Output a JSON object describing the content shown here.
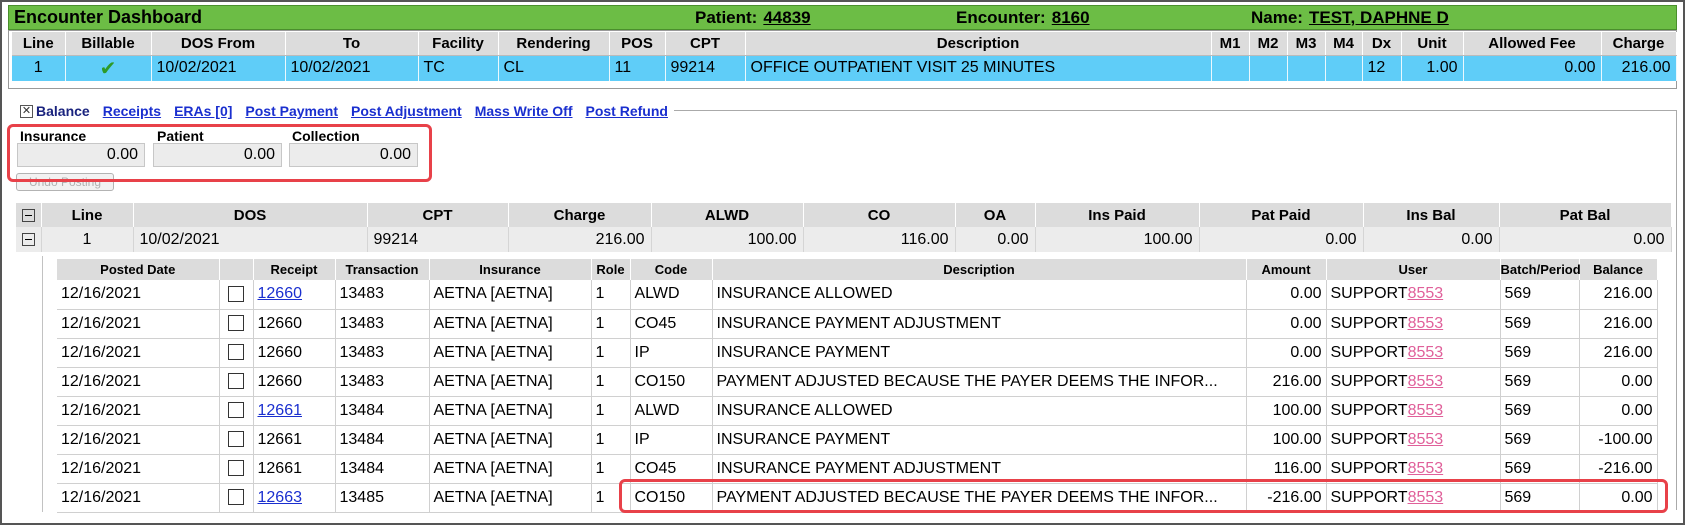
{
  "header": {
    "title": "Encounter Dashboard",
    "patient_label": "Patient:",
    "patient_value": "44839",
    "encounter_label": "Encounter:",
    "encounter_value": "8160",
    "name_label": "Name:",
    "name_value": "TEST, DAPHNE D"
  },
  "encounter_grid": {
    "columns": [
      "Line",
      "Billable",
      "DOS From",
      "To",
      "Facility",
      "Rendering",
      "POS",
      "CPT",
      "Description",
      "M1",
      "M2",
      "M3",
      "M4",
      "Dx",
      "Unit",
      "Allowed Fee",
      "Charge"
    ],
    "row": {
      "line": "1",
      "billable": "check-icon",
      "dos_from": "10/02/2021",
      "to": "10/02/2021",
      "facility": "TC",
      "rendering": "CL",
      "pos": "11",
      "cpt": "99214",
      "description": "OFFICE OUTPATIENT VISIT 25 MINUTES",
      "m1": "",
      "m2": "",
      "m3": "",
      "m4": "",
      "dx": "12",
      "unit": "1.00",
      "allowed_fee": "0.00",
      "charge": "216.00"
    }
  },
  "tabs": {
    "balance": "Balance",
    "receipts": "Receipts",
    "eras": "ERAs [0]",
    "post_payment": "Post Payment",
    "post_adjustment": "Post Adjustment",
    "mass_write_off": "Mass Write Off",
    "post_refund": "Post Refund"
  },
  "balance": {
    "insurance_label": "Insurance",
    "insurance_value": "0.00",
    "patient_label": "Patient",
    "patient_value": "0.00",
    "collection_label": "Collection",
    "collection_value": "0.00",
    "undo_label": "Undo Posting"
  },
  "detail_grid": {
    "columns": [
      "",
      "Line",
      "DOS",
      "CPT",
      "Charge",
      "ALWD",
      "CO",
      "OA",
      "Ins Paid",
      "Pat Paid",
      "Ins Bal",
      "Pat Bal"
    ],
    "row": {
      "line": "1",
      "dos": "10/02/2021",
      "cpt": "99214",
      "charge": "216.00",
      "alwd": "100.00",
      "co": "116.00",
      "oa": "0.00",
      "ins_paid": "100.00",
      "pat_paid": "0.00",
      "ins_bal": "0.00",
      "pat_bal": "0.00"
    }
  },
  "postings": {
    "columns": [
      "Posted Date",
      "",
      "Receipt",
      "Transaction",
      "Insurance",
      "Role",
      "Code",
      "Description",
      "Amount",
      "User",
      "Batch/Period",
      "Balance"
    ],
    "rows": [
      {
        "date": "12/16/2021",
        "receipt": "12660",
        "receipt_link": true,
        "transaction": "13483",
        "insurance": "AETNA [AETNA]",
        "role": "1",
        "code": "ALWD",
        "description": "INSURANCE ALLOWED",
        "amount": "0.00",
        "user": "SUPPORT",
        "user_id": "8553",
        "batch": "569",
        "balance": "216.00"
      },
      {
        "date": "12/16/2021",
        "receipt": "12660",
        "receipt_link": false,
        "transaction": "13483",
        "insurance": "AETNA [AETNA]",
        "role": "1",
        "code": "CO45",
        "description": "INSURANCE PAYMENT ADJUSTMENT",
        "amount": "0.00",
        "user": "SUPPORT",
        "user_id": "8553",
        "batch": "569",
        "balance": "216.00"
      },
      {
        "date": "12/16/2021",
        "receipt": "12660",
        "receipt_link": false,
        "transaction": "13483",
        "insurance": "AETNA [AETNA]",
        "role": "1",
        "code": "IP",
        "description": "INSURANCE PAYMENT",
        "amount": "0.00",
        "user": "SUPPORT",
        "user_id": "8553",
        "batch": "569",
        "balance": "216.00"
      },
      {
        "date": "12/16/2021",
        "receipt": "12660",
        "receipt_link": false,
        "transaction": "13483",
        "insurance": "AETNA [AETNA]",
        "role": "1",
        "code": "CO150",
        "description": "PAYMENT ADJUSTED BECAUSE THE PAYER DEEMS THE INFOR...",
        "amount": "216.00",
        "user": "SUPPORT",
        "user_id": "8553",
        "batch": "569",
        "balance": "0.00"
      },
      {
        "date": "12/16/2021",
        "receipt": "12661",
        "receipt_link": true,
        "transaction": "13484",
        "insurance": "AETNA [AETNA]",
        "role": "1",
        "code": "ALWD",
        "description": "INSURANCE ALLOWED",
        "amount": "100.00",
        "user": "SUPPORT",
        "user_id": "8553",
        "batch": "569",
        "balance": "0.00"
      },
      {
        "date": "12/16/2021",
        "receipt": "12661",
        "receipt_link": false,
        "transaction": "13484",
        "insurance": "AETNA [AETNA]",
        "role": "1",
        "code": "IP",
        "description": "INSURANCE PAYMENT",
        "amount": "100.00",
        "user": "SUPPORT",
        "user_id": "8553",
        "batch": "569",
        "balance": "-100.00"
      },
      {
        "date": "12/16/2021",
        "receipt": "12661",
        "receipt_link": false,
        "transaction": "13484",
        "insurance": "AETNA [AETNA]",
        "role": "1",
        "code": "CO45",
        "description": "INSURANCE PAYMENT ADJUSTMENT",
        "amount": "116.00",
        "user": "SUPPORT",
        "user_id": "8553",
        "batch": "569",
        "balance": "-216.00"
      },
      {
        "date": "12/16/2021",
        "receipt": "12663",
        "receipt_link": true,
        "transaction": "13485",
        "insurance": "AETNA [AETNA]",
        "role": "1",
        "code": "CO150",
        "description": "PAYMENT ADJUSTED BECAUSE THE PAYER DEEMS THE INFOR...",
        "amount": "-216.00",
        "user": "SUPPORT",
        "user_id": "8553",
        "batch": "569",
        "balance": "0.00"
      }
    ]
  },
  "colors": {
    "header_green": "#6cbd45",
    "selected_row_blue": "#5fcdf8",
    "highlight_red": "#e84149",
    "link_blue": "#1a2fcf",
    "user_link_pink": "#e0609a"
  }
}
